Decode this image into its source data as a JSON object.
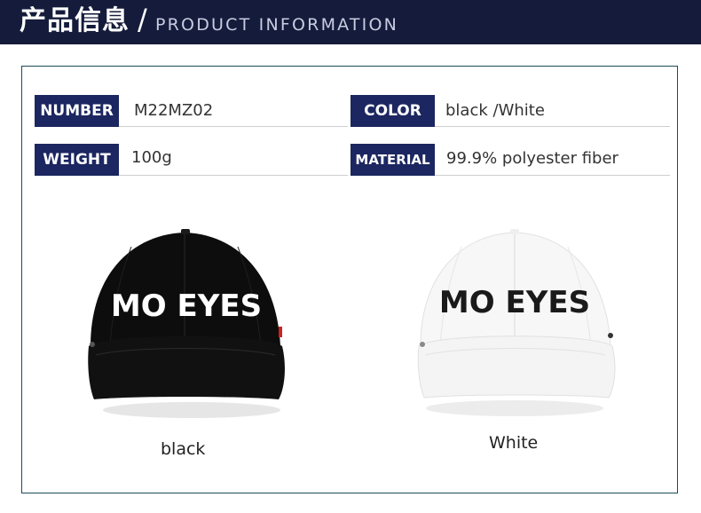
{
  "header": {
    "title_cn": "产品信息",
    "separator": "/",
    "title_en": "PRODUCT INFORMATION"
  },
  "specs": {
    "number": {
      "label": "NUMBER",
      "value": "M22MZ02"
    },
    "color": {
      "label": "COLOR",
      "value": "black /White"
    },
    "weight": {
      "label": "WEIGHT",
      "value": "100g"
    },
    "material": {
      "label": "MATERIAL",
      "value": "99.9% polyester fiber"
    }
  },
  "products": [
    {
      "caption": "black",
      "logo_text": "MO EYES",
      "cap_color": "#0d0d0d",
      "logo_color": "#ffffff"
    },
    {
      "caption": "White",
      "logo_text": "MO EYES",
      "cap_color": "#f7f7f7",
      "logo_color": "#1a1a1a"
    }
  ],
  "colors": {
    "header_bg": "#151b3b",
    "label_bg": "#1c2660",
    "frame_border": "#1e4b56"
  }
}
